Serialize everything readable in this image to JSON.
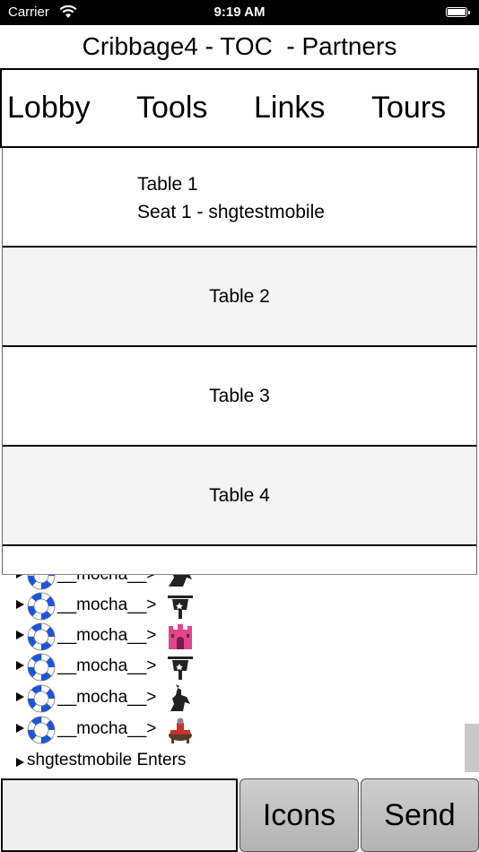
{
  "status_bar": {
    "carrier": "Carrier",
    "time": "9:19 AM"
  },
  "title": "Cribbage4 - TOC  - Partners",
  "nav": {
    "lobby": "Lobby",
    "tools": "Tools",
    "links": "Links",
    "tours": "Tours"
  },
  "tables": [
    {
      "line1": "Table 1",
      "line2": "Seat 1 - shgtestmobile"
    },
    {
      "label": "Table 2"
    },
    {
      "label": "Table 3"
    },
    {
      "label": "Table 4"
    }
  ],
  "chat": {
    "messages": [
      {
        "name": "__mocha__>",
        "icon": "knight-icon"
      },
      {
        "name": "__mocha__>",
        "icon": "trumpet-icon"
      },
      {
        "name": "__mocha__>",
        "icon": "castle-icon"
      },
      {
        "name": "__mocha__>",
        "icon": "trumpet-icon"
      },
      {
        "name": "__mocha__>",
        "icon": "knight-icon"
      },
      {
        "name": "__mocha__>",
        "icon": "knight-rider-icon"
      }
    ],
    "enter_text": "shgtestmobile Enters"
  },
  "input": {
    "placeholder": ""
  },
  "buttons": {
    "icons": "Icons",
    "send": "Send"
  },
  "colors": {
    "ring": "#1a55e0",
    "button": "#c0c0c0"
  }
}
